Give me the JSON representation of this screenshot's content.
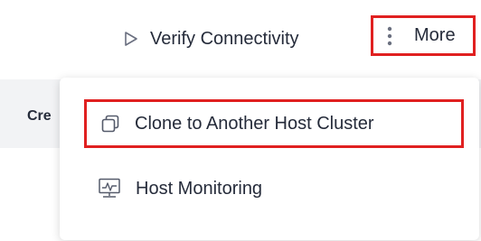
{
  "toolbar": {
    "verify_label": "Verify Connectivity",
    "more_label": "More"
  },
  "table": {
    "first_column_partial": "Cre"
  },
  "dropdown": {
    "items": [
      {
        "label": "Clone to Another Host Cluster",
        "icon": "clone-icon"
      },
      {
        "label": "Host Monitoring",
        "icon": "monitor-icon"
      }
    ]
  },
  "colors": {
    "highlight_border": "#e02020",
    "text": "#252b3a",
    "table_header_bg": "#f2f3f5"
  }
}
